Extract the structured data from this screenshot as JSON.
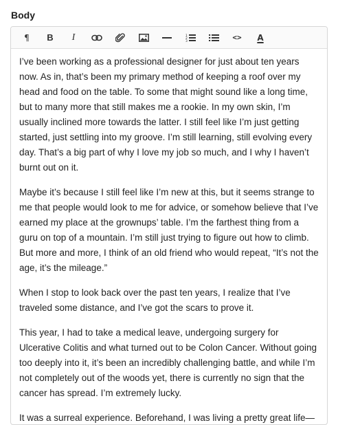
{
  "field": {
    "label": "Body"
  },
  "toolbar": {
    "buttons": [
      {
        "name": "paragraph-button",
        "icon": "pilcrow-icon",
        "glyph": "¶",
        "style": "text"
      },
      {
        "name": "bold-button",
        "icon": "bold-icon",
        "glyph": "B",
        "style": "bold"
      },
      {
        "name": "italic-button",
        "icon": "italic-icon",
        "glyph": "I",
        "style": "italic"
      },
      {
        "name": "link-button",
        "icon": "link-icon",
        "style": "svg"
      },
      {
        "name": "unlink-button",
        "icon": "paperclip-icon",
        "style": "svg"
      },
      {
        "name": "image-button",
        "icon": "image-icon",
        "style": "svg"
      },
      {
        "name": "horizontal-rule-button",
        "icon": "horizontal-rule-icon",
        "style": "svg"
      },
      {
        "name": "ordered-list-button",
        "icon": "ordered-list-icon",
        "style": "svg"
      },
      {
        "name": "bullet-list-button",
        "icon": "bullet-list-icon",
        "style": "svg"
      },
      {
        "name": "code-button",
        "icon": "code-icon",
        "glyph": "<>",
        "style": "code"
      },
      {
        "name": "clear-format-button",
        "icon": "clear-format-icon",
        "glyph": "A",
        "style": "clear"
      }
    ]
  },
  "content": {
    "paragraphs": [
      "I’ve been working as a professional designer for just about ten years now. As in, that’s been my primary method of keeping a roof over my head and food on the table. To some that might sound like a long time, but to many more that still makes me a rookie. In my own skin, I’m usually inclined more towards the latter. I still feel like I’m just getting started, just settling into my groove. I’m still learning, still evolving every day. That’s a big part of why I love my job so much, and I why I haven’t burnt out on it.",
      "Maybe it’s because I still feel like I’m new at this, but it seems strange to me that people would look to me for advice, or somehow believe that I’ve earned my place at the grownups’ table. I’m the farthest thing from a guru on top of a mountain. I’m still just trying to figure out how to climb. But more and more, I think of an old friend who would repeat, “It’s not the age, it’s the mileage.”",
      "When I stop to look back over the past ten years, I realize that I’ve traveled some distance, and I’ve got the scars to prove it.",
      "This year, I had to take a medical leave, undergoing surgery for Ulcerative Colitis and what turned out to be Colon Cancer. Without going too deeply into it, it’s been an incredibly challenging battle, and while I’m not completely out of the woods yet, there is currently no sign that the cancer has spread. I’m extremely lucky.",
      "It was a surreal experience. Beforehand, I was living a pretty great life—"
    ]
  }
}
